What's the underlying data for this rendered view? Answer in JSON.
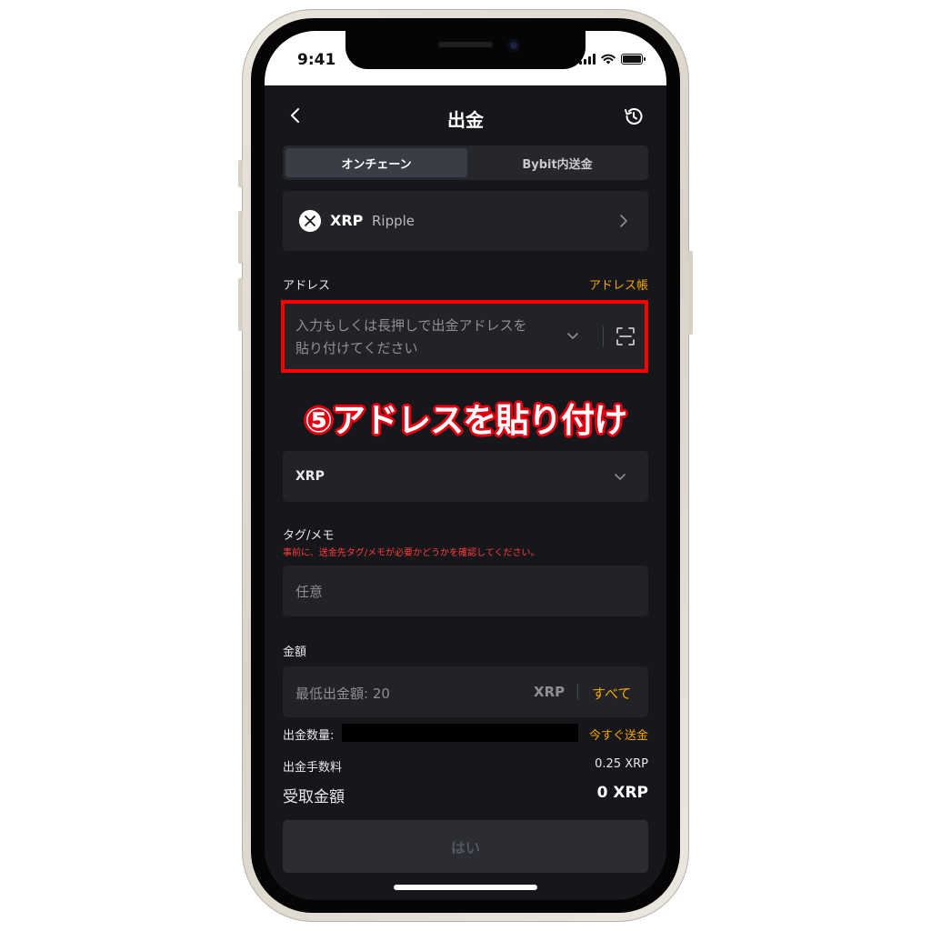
{
  "status_bar": {
    "time": "9:41"
  },
  "header": {
    "title": "出金"
  },
  "tabs": [
    {
      "label": "オンチェーン",
      "active": true
    },
    {
      "label": "Bybit内送金",
      "active": false
    }
  ],
  "coin": {
    "symbol": "XRP",
    "name": "Ripple",
    "icon": "xrp-icon"
  },
  "address": {
    "label": "アドレス",
    "book_link": "アドレス帳",
    "placeholder_line1": "入力もしくは長押しで出金アドレスを",
    "placeholder_line2": "貼り付けてください"
  },
  "annotation": {
    "text": "⑤アドレスを貼り付け"
  },
  "network": {
    "value": "XRP"
  },
  "memo": {
    "label": "タグ/メモ",
    "warning": "事前に、送金先タグ/メモが必要かどうかを確認してください。",
    "placeholder": "任意"
  },
  "amount": {
    "label": "金額",
    "placeholder": "最低出金額: 20",
    "unit": "XRP",
    "all_label": "すべて"
  },
  "summary": {
    "withdraw_qty_label": "出金数量:",
    "send_now_link": "今すぐ送金",
    "fee_label": "出金手数料",
    "fee_value": "0.25 XRP",
    "receive_label": "受取金額",
    "receive_value": "0 XRP"
  },
  "confirm": {
    "label": "はい"
  },
  "colors": {
    "accent": "#f7a600",
    "warning": "#ff3b3b",
    "highlight": "#ff0000",
    "background": "#16171b",
    "card": "#222327"
  }
}
